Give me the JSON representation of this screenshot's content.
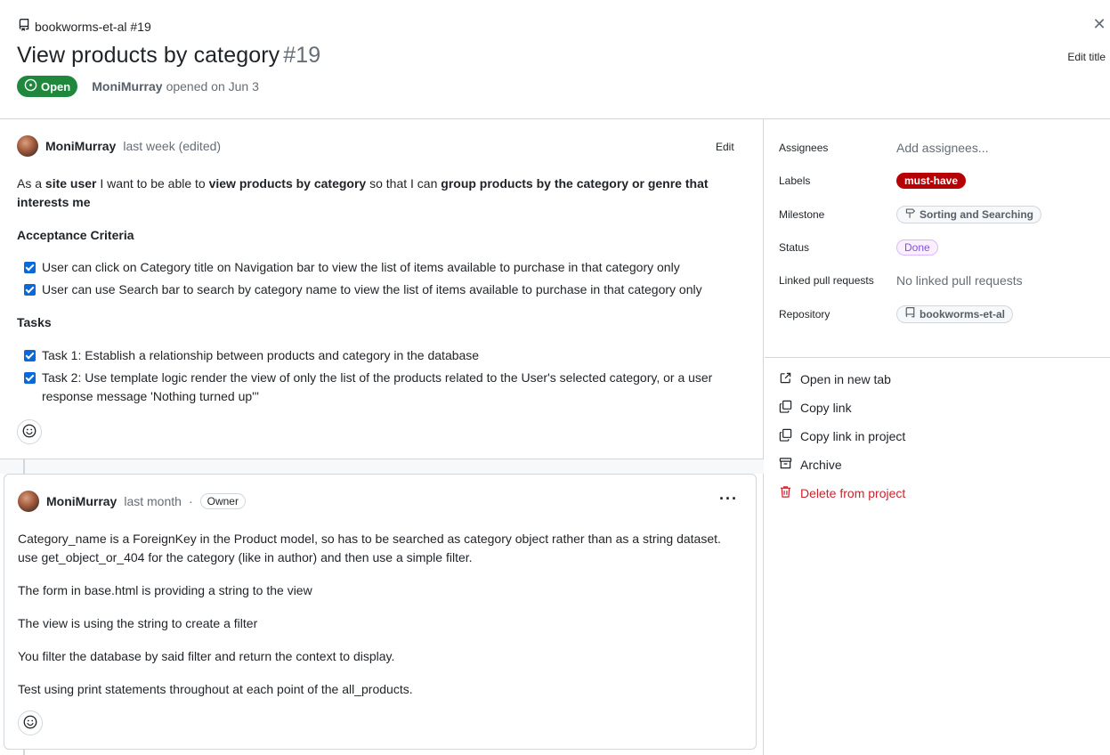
{
  "header": {
    "repo": "bookworms-et-al #19",
    "title": "View products by category",
    "number": "#19",
    "status": "Open",
    "author": "MoniMurray",
    "opened_text": "opened on Jun 3",
    "edit_title_label": "Edit title",
    "close_glyph": "✕"
  },
  "comment1": {
    "author": "MoniMurray",
    "time": "last week (edited)",
    "edit_label": "Edit",
    "body": {
      "p1_a": "As a ",
      "p1_b": "site user",
      "p1_c": " I want to be able to ",
      "p1_d": "view products by category",
      "p1_e": " so that I can ",
      "p1_f": "group products by the category or genre that interests me"
    },
    "acceptance_heading": "Acceptance Criteria",
    "acceptance": [
      "User can click on Category title on Navigation bar to view the list of items available to purchase in that category only",
      "User can use Search bar to search by category name to view the list of items available to purchase in that category only"
    ],
    "tasks_heading": "Tasks",
    "tasks": [
      "Task 1: Establish a relationship between products and category in the database",
      "Task 2: Use template logic render the view of only the list of the products related to the User's selected category, or a user response message 'Nothing turned up'\""
    ]
  },
  "comment2": {
    "author": "MoniMurray",
    "time": "last month",
    "separator": "·",
    "badge": "Owner",
    "more_glyph": "···",
    "paragraphs": [
      "Category_name is a ForeignKey in the Product model, so has to be searched as category object rather than as a string dataset. use get_object_or_404 for the category (like in author) and then use a simple filter.",
      "The form in base.html is providing a string to the view",
      "The view is using the string to create a filter",
      "You filter the database by said filter and return the context to display.",
      "Test using print statements throughout at each point of the all_products."
    ]
  },
  "sidebar": {
    "assignees_label": "Assignees",
    "assignees_value": "Add assignees...",
    "labels_label": "Labels",
    "labels_value": "must-have",
    "milestone_label": "Milestone",
    "milestone_value": "Sorting and Searching",
    "status_label": "Status",
    "status_value": "Done",
    "linked_label": "Linked pull requests",
    "linked_value": "No linked pull requests",
    "repository_label": "Repository",
    "repository_value": "bookworms-et-al",
    "actions": {
      "open_new_tab": "Open in new tab",
      "copy_link": "Copy link",
      "copy_link_project": "Copy link in project",
      "archive": "Archive",
      "delete": "Delete from project"
    }
  },
  "colors": {
    "open_green": "#1f883d",
    "label_red": "#b60205",
    "done_purple": "#8250df",
    "danger": "#cf222e",
    "checkbox_blue": "#0969da"
  }
}
